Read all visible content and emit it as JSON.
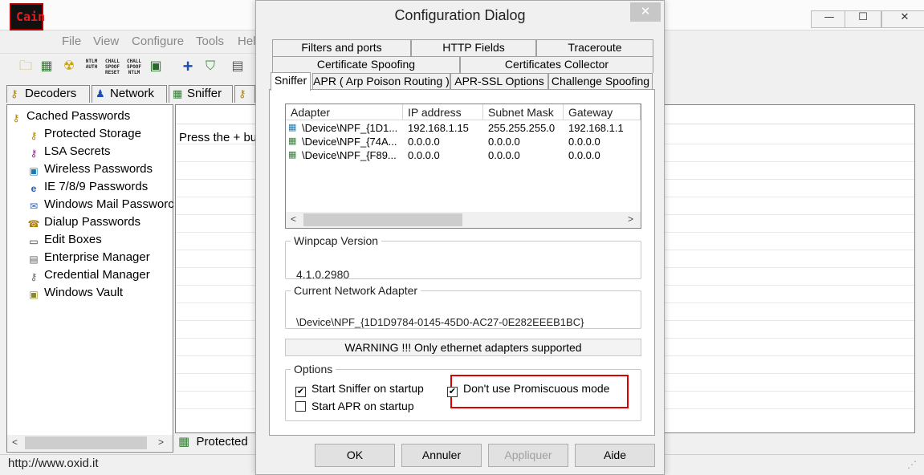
{
  "app": {
    "logo_text": "Cain",
    "window_controls": [
      "—",
      "☐",
      "✕"
    ],
    "menu": [
      "File",
      "View",
      "Configure",
      "Tools",
      "Hel"
    ],
    "toolbar_icons": [
      "folder-icon",
      "network-card-icon",
      "radiation-icon",
      "ntlm-auth-icon",
      "chall-spoof-reset-icon",
      "chall-spoof-ntlm-icon",
      "monitor-icon",
      "plus-icon",
      "shield-icon",
      "scan-icon"
    ],
    "toolbar_text_icons": {
      "ntlm_auth": "NTLM AUTH",
      "chall_reset": "CHALL SPOOF RESET",
      "chall_ntlm": "CHALL SPOOF NTLM"
    },
    "tabs": [
      "Decoders",
      "Network",
      "Sniffer"
    ],
    "tree": {
      "root": "Cached Passwords",
      "children": [
        "Protected Storage",
        "LSA Secrets",
        "Wireless Passwords",
        "IE 7/8/9 Passwords",
        "Windows Mail Passworc",
        "Dialup Passwords",
        "Edit Boxes",
        "Enterprise Manager",
        "Credential Manager",
        "Windows Vault"
      ]
    },
    "content_text": "Press the + but",
    "bottom_tab": "Protected",
    "status_url": "http://www.oxid.it"
  },
  "dialog": {
    "title": "Configuration Dialog",
    "close_label": "✕",
    "tabs_row1": [
      "Filters and ports",
      "HTTP Fields",
      "Traceroute"
    ],
    "tabs_row2": [
      "Certificate Spoofing",
      "Certificates Collector"
    ],
    "tabs_row3": [
      "Sniffer",
      "APR ( Arp Poison Routing )",
      "APR-SSL Options",
      "Challenge Spoofing"
    ],
    "active_tab": "Sniffer",
    "adapter_list": {
      "columns": [
        "Adapter",
        "IP address",
        "Subnet Mask",
        "Gateway"
      ],
      "rows": [
        [
          "\\Device\\NPF_{1D1...",
          "192.168.1.15",
          "255.255.255.0",
          "192.168.1.1"
        ],
        [
          "\\Device\\NPF_{74A...",
          "0.0.0.0",
          "0.0.0.0",
          "0.0.0.0"
        ],
        [
          "\\Device\\NPF_{F89...",
          "0.0.0.0",
          "0.0.0.0",
          "0.0.0.0"
        ]
      ],
      "scroll_left": "<",
      "scroll_right": ">"
    },
    "winpcap": {
      "label": "Winpcap Version",
      "value": "4.1.0.2980"
    },
    "current_adapter": {
      "label": "Current Network Adapter",
      "value": "\\Device\\NPF_{1D1D9784-0145-45D0-AC27-0E282EEEB1BC}"
    },
    "warning": "WARNING !!! Only ethernet adapters supported",
    "options": {
      "label": "Options",
      "start_sniffer": {
        "label": "Start Sniffer on startup",
        "checked": true
      },
      "start_apr": {
        "label": "Start APR on startup",
        "checked": false
      },
      "no_promiscuous": {
        "label": "Don't use Promiscuous mode",
        "checked": true
      }
    },
    "buttons": {
      "ok": "OK",
      "cancel": "Annuler",
      "apply": "Appliquer",
      "help": "Aide"
    },
    "highlight_color": "#e00000"
  }
}
